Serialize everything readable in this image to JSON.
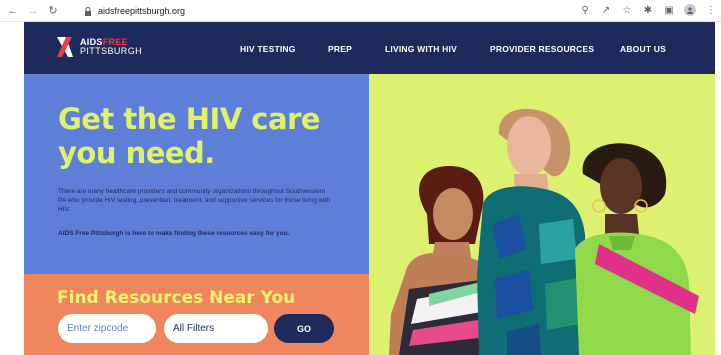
{
  "browser": {
    "url": "aidsfreepittsburgh.org"
  },
  "logo": {
    "aids": "AIDS",
    "free": "FREE",
    "city": "PITTSBURGH"
  },
  "nav": {
    "items": [
      {
        "label": "HIV TESTING"
      },
      {
        "label": "PREP"
      },
      {
        "label": "LIVING WITH HIV"
      },
      {
        "label": "PROVIDER RESOURCES"
      },
      {
        "label": "ABOUT US"
      }
    ]
  },
  "hero": {
    "title_line1": "Get the HIV care",
    "title_line2": "you need.",
    "body": "There are many healthcare providers and community organizations throughout Southwestern PA who provide HIV testing, prevention, treatment, and supportive services for those living with HIV.",
    "emphasis": "AIDS Free Pittsburgh is here to make finding these resources easy for you."
  },
  "find": {
    "title": "Find Resources Near You",
    "zip_placeholder": "Enter zipcode",
    "filter_label": "All Filters",
    "go_label": "GO"
  },
  "colors": {
    "navy": "#1f2a5c",
    "blue": "#5e7fd8",
    "lime": "#dff26a",
    "coral": "#f0865d",
    "red": "#ee3a43"
  }
}
